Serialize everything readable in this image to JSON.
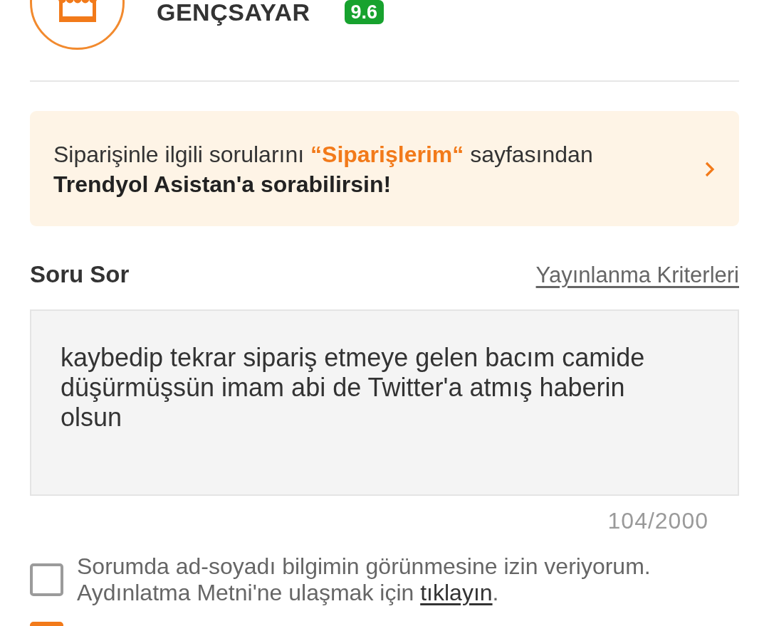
{
  "store": {
    "name": "GENÇSAYAR",
    "rating": "9.6"
  },
  "info_banner": {
    "segments": [
      {
        "kind": "plain",
        "text": "Siparişinle ilgili sorularını "
      },
      {
        "kind": "accent",
        "text": "“Siparişlerim“"
      },
      {
        "kind": "plain",
        "text": " sayfasından "
      },
      {
        "kind": "strong",
        "text": "Trendyol Asistan'a sorabilirsin!"
      }
    ]
  },
  "question_form": {
    "title": "Soru Sor",
    "criteria_link": "Yayınlanma Kriterleri",
    "value": "kaybedip tekrar sipariş etmeye gelen bacım camide düşürmüşsün imam abi de Twitter'a atmış haberin olsun",
    "counter": "104/2000"
  },
  "consents": [
    {
      "checked": false,
      "text": "Sorumda ad-soyadı bilgimin görünmesine izin veriyorum. Aydınlatma Metni'ne ulaşmak için ",
      "link": "tıklayın",
      "after": "."
    },
    {
      "checked": true
    }
  ]
}
